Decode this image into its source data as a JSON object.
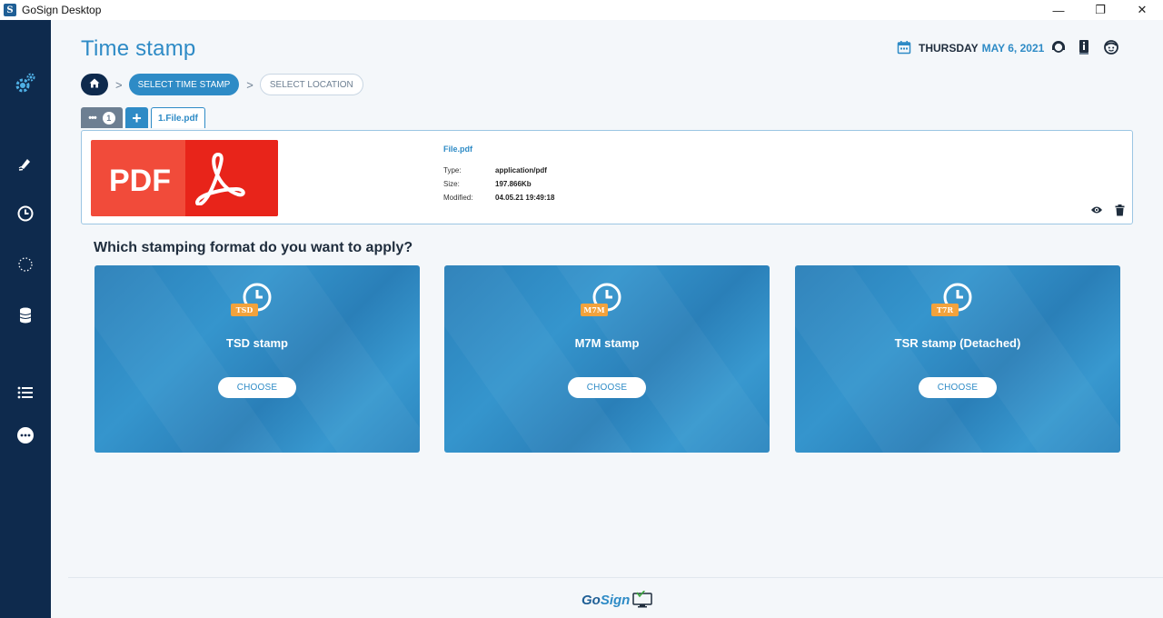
{
  "window": {
    "title": "GoSign Desktop",
    "app_logo_letter": "S",
    "controls": {
      "minimize": "—",
      "maximize": "❐",
      "close": "✕"
    }
  },
  "sidebar": {
    "items": [
      {
        "icon": "settings-gear-icon"
      },
      {
        "icon": "signature-pen-icon"
      },
      {
        "icon": "clock-icon"
      },
      {
        "icon": "dotted-circle-icon"
      },
      {
        "icon": "database-icon"
      },
      {
        "icon": "list-icon"
      },
      {
        "icon": "more-options-icon"
      }
    ]
  },
  "header": {
    "title": "Time stamp",
    "date_day": "THURSDAY",
    "date_rest": "MAY 6, 2021",
    "icons": [
      "calendar-icon",
      "support-agent-icon",
      "info-book-icon",
      "user-face-icon"
    ]
  },
  "breadcrumb": {
    "home_icon": "home-icon",
    "step1": "SELECT TIME STAMP",
    "step2": "SELECT LOCATION",
    "separator": ">"
  },
  "file_tabs": {
    "group_dots": "•••",
    "count": "1",
    "add_label": "+",
    "file_tab_label": "1.File.pdf"
  },
  "file_card": {
    "thumbnail_text": "PDF",
    "name": "File.pdf",
    "type_label": "Type:",
    "type_value": "application/pdf",
    "size_label": "Size:",
    "size_value": "197.866Kb",
    "modified_label": "Modified:",
    "modified_value": "04.05.21 19:49:18"
  },
  "question": "Which stamping format do you want to apply?",
  "stamp_options": [
    {
      "badge": "TSD",
      "title": "TSD stamp",
      "button": "CHOOSE"
    },
    {
      "badge": "M7M",
      "title": "M7M stamp",
      "button": "CHOOSE"
    },
    {
      "badge": "T7R",
      "title": "TSR stamp (Detached)",
      "button": "CHOOSE"
    }
  ],
  "footer": {
    "logo_go": "Go",
    "logo_sign": "Sign"
  },
  "colors": {
    "sidebar": "#0e2a4d",
    "accent": "#2e8bc6",
    "card": "#2e8bc6",
    "badge": "#f2a23c",
    "pdf_red": "#f14b3a"
  }
}
